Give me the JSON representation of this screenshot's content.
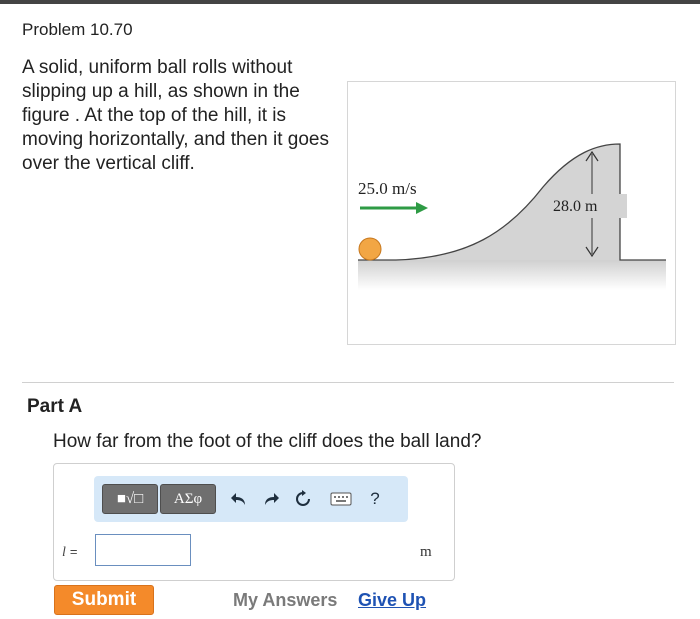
{
  "problem": {
    "title": "Problem 10.70",
    "statement": "A solid, uniform ball rolls without slipping up a hill, as shown in the figure . At the top of the hill, it is moving horizontally, and then it goes over the vertical cliff."
  },
  "figure": {
    "speed_label": "25.0 m/s",
    "height_label": "28.0 m",
    "colors": {
      "hill": "#d4d4d4",
      "ball": "#f2a644",
      "arrow": "#2e9b45"
    }
  },
  "part": {
    "title": "Part A",
    "question": "How far from the foot of the cliff does the ball land?"
  },
  "toolbar": {
    "templates_label": "■√□",
    "symbols_label": "ΑΣφ",
    "undo_icon": "undo-icon",
    "redo_icon": "redo-icon",
    "reset_icon": "reset-icon",
    "keyboard_icon": "keyboard-icon",
    "help_label": "?"
  },
  "answer": {
    "variable": "l",
    "equals": "=",
    "value": "",
    "unit": "m"
  },
  "actions": {
    "submit_label": "Submit",
    "my_answers_label": "My Answers",
    "give_up_label": "Give Up"
  }
}
